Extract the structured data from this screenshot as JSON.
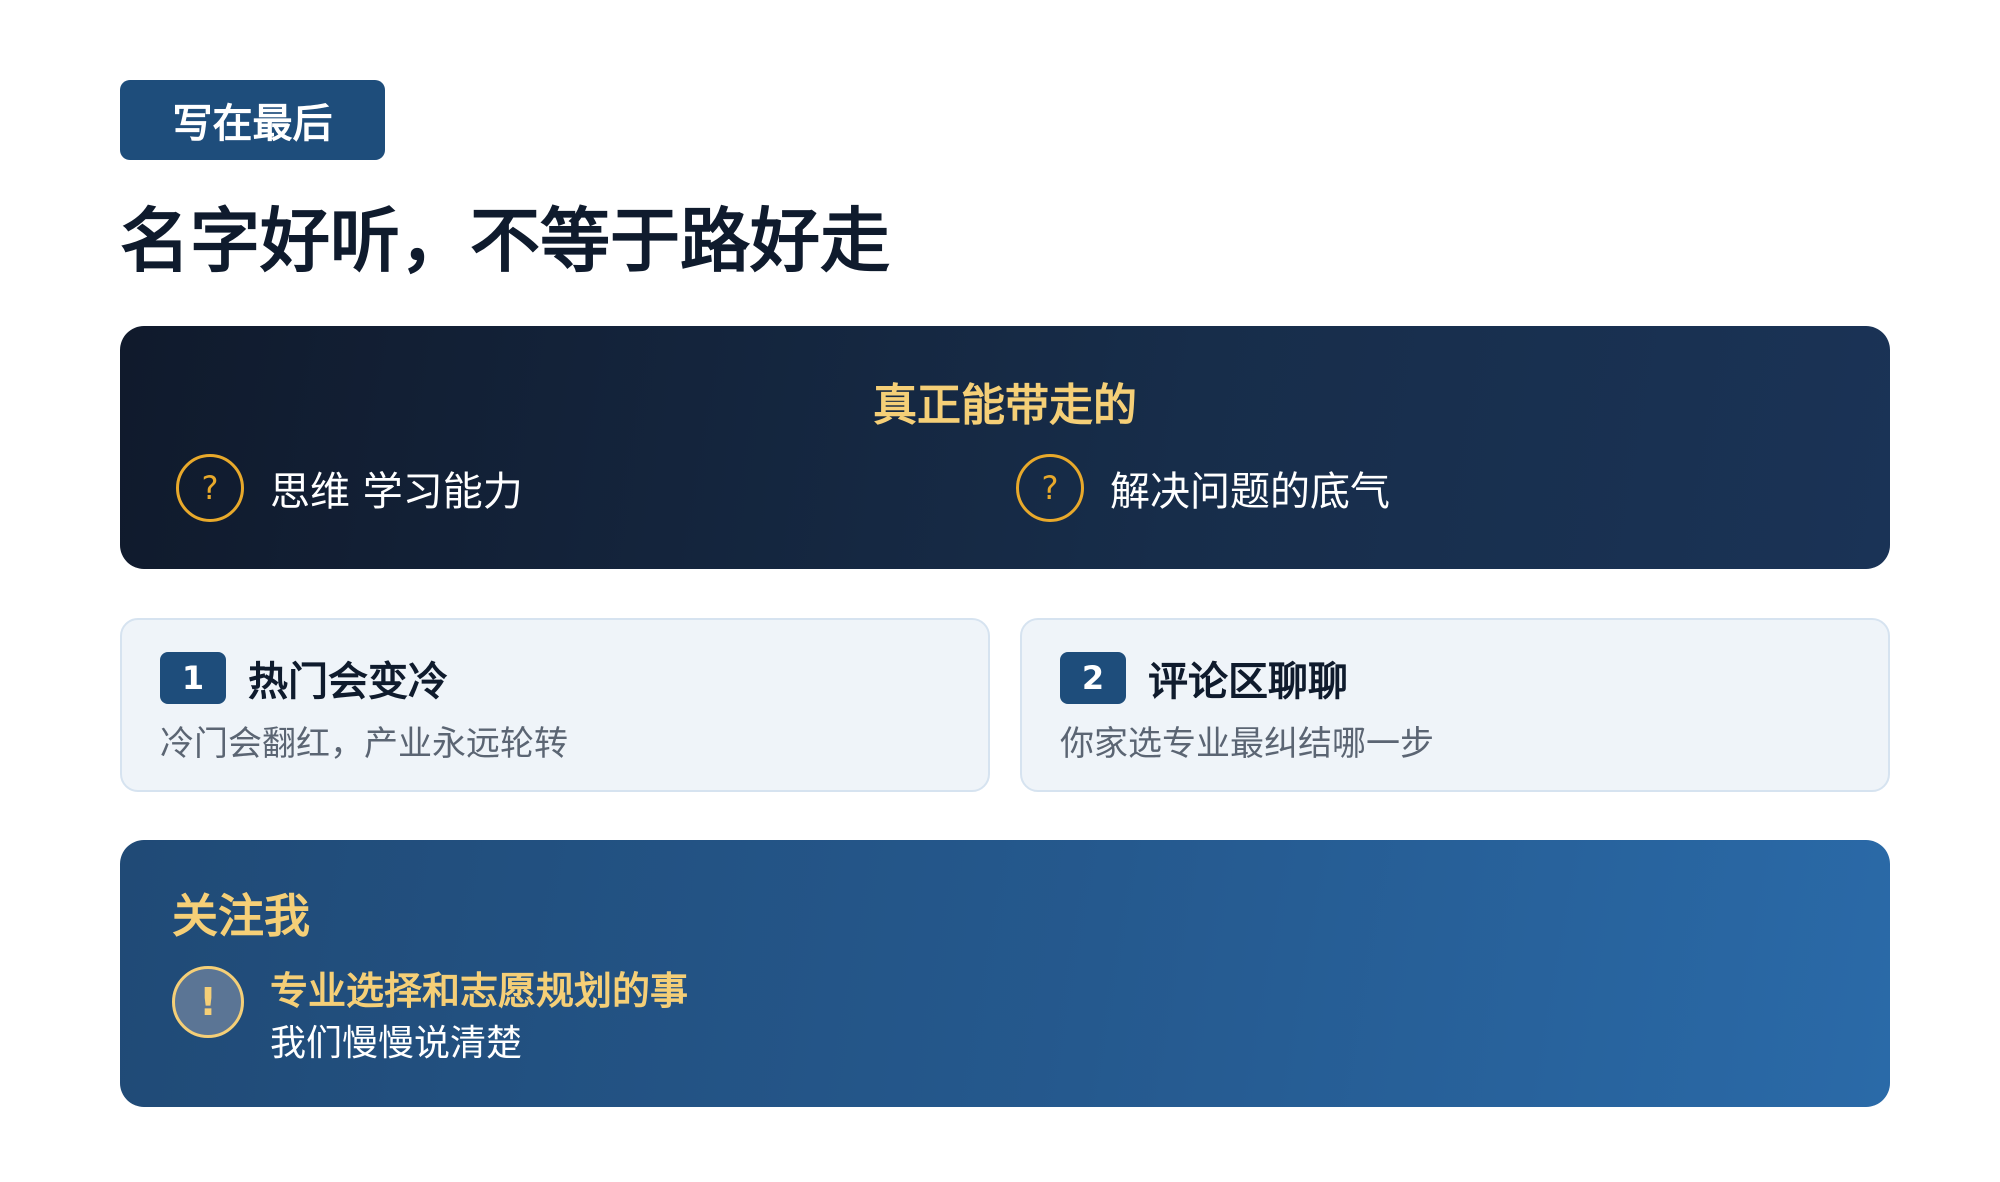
{
  "header": {
    "tag": "写在最后",
    "title": "名字好听，不等于路好走"
  },
  "takeaways": {
    "title": "真正能带走的",
    "items": [
      {
        "icon": "?",
        "text": "思维 学习能力"
      },
      {
        "icon": "?",
        "text": "解决问题的底气"
      }
    ]
  },
  "cards": [
    {
      "number": "1",
      "title": "热门会变冷",
      "subtitle": "冷门会翻红，产业永远轮转"
    },
    {
      "number": "2",
      "title": "评论区聊聊",
      "subtitle": "你家选专业最纠结哪一步"
    }
  ],
  "follow": {
    "title": "关注我",
    "icon": "!",
    "line1": "专业选择和志愿规划的事",
    "line2": "我们慢慢说清楚"
  },
  "colors": {
    "accent": "#1e4d7b",
    "gold": "#f5cf77",
    "dark": "#0f1b2d"
  }
}
